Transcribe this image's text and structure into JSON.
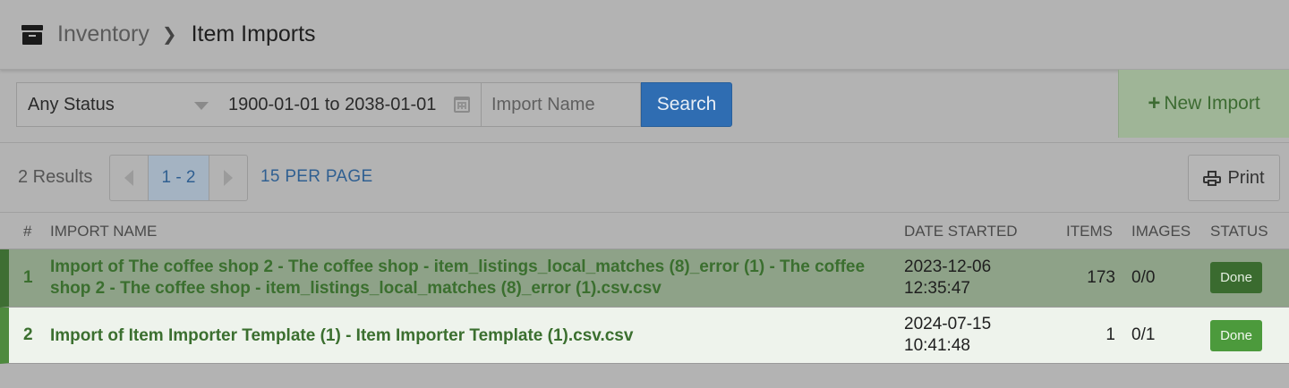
{
  "header": {
    "breadcrumb_root": "Inventory",
    "breadcrumb_current": "Item Imports",
    "icon": "archive-box-icon"
  },
  "filters": {
    "status_value": "Any Status",
    "date_range": "1900-01-01 to 2038-01-01",
    "name_placeholder": "Import Name",
    "search_label": "Search",
    "new_import_label": "New Import"
  },
  "toolbar": {
    "results_text": "2 Results",
    "page_range": "1 - 2",
    "per_page": "15 PER PAGE",
    "print_label": "Print"
  },
  "table": {
    "columns": [
      "#",
      "IMPORT NAME",
      "DATE STARTED",
      "ITEMS",
      "IMAGES",
      "STATUS"
    ],
    "rows": [
      {
        "num": "1",
        "name": "Import of The coffee shop 2 - The coffee shop - item_listings_local_matches (8)_error (1) - The coffee shop 2 - The coffee shop - item_listings_local_matches (8)_error (1).csv.csv",
        "date": "2023-12-06 12:35:47",
        "items": "173",
        "images": "0/0",
        "status": "Done"
      },
      {
        "num": "2",
        "name": "Import of Item Importer Template (1) - Item Importer Template (1).csv.csv",
        "date": "2024-07-15 10:41:48",
        "items": "1",
        "images": "0/1",
        "status": "Done"
      }
    ]
  },
  "colors": {
    "accent_blue": "#2f6db2",
    "success_green": "#4c9a3c",
    "link_green": "#3b6f2f"
  }
}
